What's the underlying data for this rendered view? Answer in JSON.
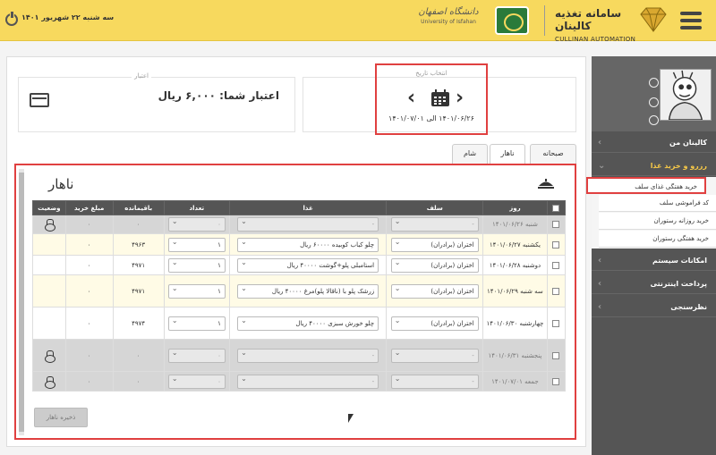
{
  "header": {
    "date": "سه شنبه ۲۲ شهریور ۱۴۰۱",
    "university_fa": "دانشگاه اصفهان",
    "university_en": "University of Isfahan",
    "app_name_fa": "سامانه تغذیه کالینان",
    "app_name_en": "CULLINAN AUTOMATION",
    "icons": [
      "power-icon",
      "menu-icon",
      "diamond-logo-icon"
    ]
  },
  "credit": {
    "title": "اعتبار",
    "text": "اعتبار شما: ۶,۰۰۰ ریال"
  },
  "date_picker": {
    "title": "انتخاب تاریخ",
    "range": "۱۴۰۱/۰۶/۲۶ الی ۱۴۰۱/۰۷/۰۱"
  },
  "tabs": [
    "صبحانه",
    "ناهار",
    "شام"
  ],
  "active_tab": "ناهار",
  "meal": {
    "title": "ناهار",
    "columns": [
      "",
      "روز",
      "سلف",
      "غذا",
      "تعداد",
      "باقیمانده",
      "مبلغ خرید",
      "وضعیت"
    ],
    "rows": [
      {
        "day": "شنبه ۱۴۰۱/۰۶/۲۶",
        "self": "-",
        "food": "-",
        "count": "۰",
        "remain": "۰",
        "price": "۰",
        "locked": true,
        "style": "dis"
      },
      {
        "day": "یکشنبه ۱۴۰۱/۰۶/۲۷",
        "self": "اختران (برادران)",
        "food": "چلو کباب کوبیده ۶۰۰۰۰ ریال",
        "count": "۱",
        "remain": "۴۹۶۳",
        "price": "۰",
        "locked": false,
        "style": "yel"
      },
      {
        "day": "دوشنبه ۱۴۰۱/۰۶/۲۸",
        "self": "اختران (برادران)",
        "food": "استامبلی پلو+گوشت ۴۰۰۰۰ ریال",
        "count": "۱",
        "remain": "۴۹۷۱",
        "price": "۰",
        "locked": false,
        "style": "wht"
      },
      {
        "day": "سه شنبه ۱۴۰۱/۰۶/۲۹",
        "self": "اختران (برادران)",
        "food": "زرشک پلو با (ناقالا پلو)مرغ ۴۰۰۰۰ ریال",
        "count": "۱",
        "remain": "۴۹۷۱",
        "price": "۰",
        "locked": false,
        "style": "yel"
      },
      {
        "day": "چهارشنبه ۱۴۰۱/۰۶/۳۰",
        "self": "اختران (برادران)",
        "food": "چلو خورش سبزی ۴۰۰۰۰ ریال",
        "count": "۱",
        "remain": "۴۹۷۴",
        "price": "۰",
        "locked": false,
        "style": "wht"
      },
      {
        "day": "پنجشنبه ۱۴۰۱/۰۶/۳۱",
        "self": "-",
        "food": "-",
        "count": "۰",
        "remain": "۰",
        "price": "۰",
        "locked": true,
        "style": "dis"
      },
      {
        "day": "جمعه ۱۴۰۱/۰۷/۰۱",
        "self": "-",
        "food": "-",
        "count": "۰",
        "remain": "۰",
        "price": "۰",
        "locked": true,
        "style": "dis"
      }
    ],
    "save_label": "ذخیره ناهار"
  },
  "sidebar": {
    "menu": [
      {
        "label": "کالینان من",
        "open": false
      },
      {
        "label": "رزرو و خرید غذا",
        "open": true
      },
      {
        "label": "امکانات سیستم",
        "open": false
      },
      {
        "label": "پرداخت اینترنتی",
        "open": false
      },
      {
        "label": "نظرسنجی",
        "open": false
      }
    ],
    "submenu": [
      "خرید هفتگی غذای سلف",
      "کد فراموشی سلف",
      "خرید روزانه رستوران",
      "خرید هفتگی رستوران"
    ]
  },
  "colors": {
    "header": "#f7d95e",
    "highlight": "#e04040",
    "sidebar": "#555555",
    "accent": "#f7c948"
  }
}
